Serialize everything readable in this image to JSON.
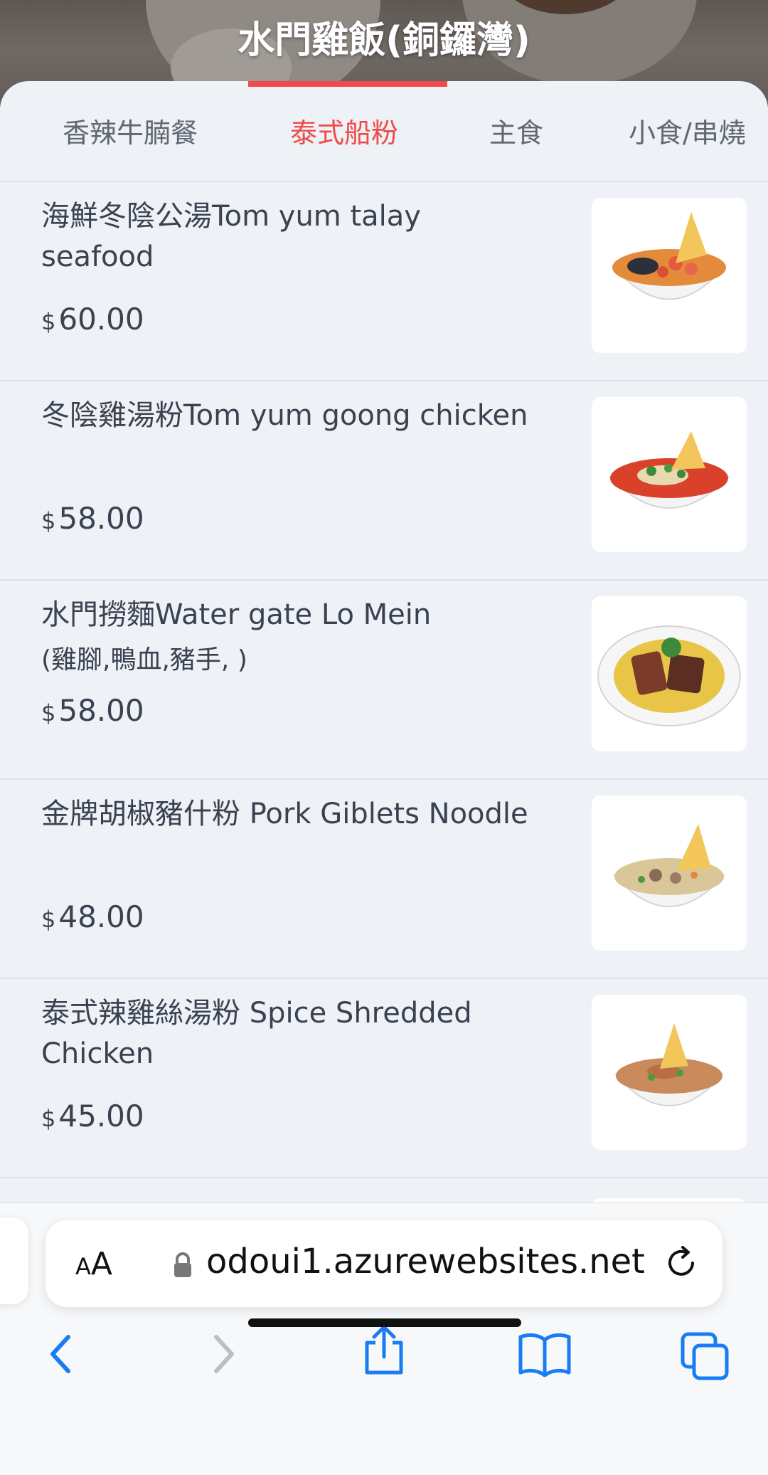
{
  "store": {
    "title": "水門雞飯(銅鑼灣)"
  },
  "tabs": [
    {
      "label": "香辣牛腩餐",
      "active": false
    },
    {
      "label": "泰式船粉",
      "active": true
    },
    {
      "label": "主食",
      "active": false
    },
    {
      "label": "小食/串燒",
      "active": false
    }
  ],
  "menu_items": [
    {
      "name": "海鮮冬陰公湯Tom yum talay seafood",
      "subtitle": "",
      "currency": "$",
      "price": "60.00",
      "image": "seafood-tom-yum-soup"
    },
    {
      "name": "冬陰雞湯粉Tom yum goong chicken",
      "subtitle": "",
      "currency": "$",
      "price": "58.00",
      "image": "tom-yum-chicken-noodle"
    },
    {
      "name": "水門撈麵Water gate Lo Mein",
      "subtitle": "(雞腳,鴨血,豬手, )",
      "currency": "$",
      "price": "58.00",
      "image": "lo-mein-bowl"
    },
    {
      "name": "金牌胡椒豬什粉 Pork Giblets Noodle",
      "subtitle": "",
      "currency": "$",
      "price": "48.00",
      "image": "pork-giblets-noodle"
    },
    {
      "name": "泰式辣雞絲湯粉 Spice Shredded Chicken",
      "subtitle": "",
      "currency": "$",
      "price": "45.00",
      "image": "shredded-chicken-noodle"
    }
  ],
  "browser": {
    "text_size_label_small": "A",
    "text_size_label_large": "A",
    "url": "odoui1.azurewebsites.net"
  },
  "colors": {
    "accent": "#ee4b4b",
    "link_blue": "#1a7cf5",
    "text": "#3a4150"
  }
}
